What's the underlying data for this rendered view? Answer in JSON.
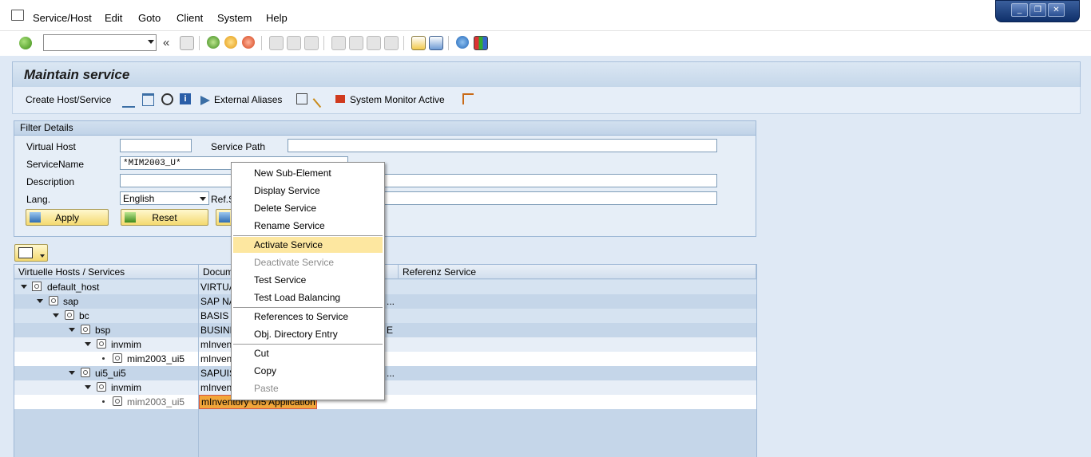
{
  "menubar": {
    "items": [
      "Service/Host",
      "Edit",
      "Goto",
      "Client",
      "System",
      "Help"
    ]
  },
  "window_controls": {
    "minimize": "_",
    "restore": "❐",
    "close": "✕"
  },
  "toolbar": {
    "command_field_value": "",
    "back_glyph": "«"
  },
  "title": "Maintain service",
  "app_toolbar": {
    "create": "Create Host/Service",
    "external_aliases": "External Aliases",
    "system_monitor": "System Monitor Active"
  },
  "filter": {
    "group_title": "Filter Details",
    "virtual_host_label": "Virtual Host",
    "virtual_host_value": "",
    "service_path_label": "Service Path",
    "service_path_value": "",
    "service_name_label": "ServiceName",
    "service_name_value": "*MIM2003_U*",
    "description_label": "Description",
    "description_value": "",
    "lang_label": "Lang.",
    "lang_value": "English",
    "ref_service_label": "Ref.S",
    "apply": "Apply",
    "reset": "Reset"
  },
  "tree": {
    "columns": [
      "Virtuelle Hosts / Services",
      "Docum",
      "Referenz Service"
    ],
    "rows": [
      {
        "name": "default_host",
        "doc": "VIRTUA",
        "extra": ""
      },
      {
        "name": "sap",
        "doc": "SAP NA",
        "extra": "..."
      },
      {
        "name": "bc",
        "doc": "BASIS T",
        "extra": ""
      },
      {
        "name": "bsp",
        "doc": "BUSINE",
        "extra": "E"
      },
      {
        "name": "invmim",
        "doc": "mInven",
        "extra": ""
      },
      {
        "name": "mim2003_ui5",
        "doc": "mInven",
        "extra": ""
      },
      {
        "name": "ui5_ui5",
        "doc": "SAPUIS",
        "extra": "..."
      },
      {
        "name": "invmim",
        "doc": "mInven",
        "extra": ""
      },
      {
        "name": "mim2003_ui5",
        "doc": "mInventory UI5 Application",
        "extra": ""
      }
    ]
  },
  "context_menu": {
    "items": [
      {
        "label": "New Sub-Element",
        "state": "normal"
      },
      {
        "label": "Display Service",
        "state": "normal"
      },
      {
        "label": "Delete Service",
        "state": "normal"
      },
      {
        "label": "Rename Service",
        "state": "normal"
      },
      {
        "label": "Activate Service",
        "state": "highlighted"
      },
      {
        "label": "Deactivate Service",
        "state": "disabled"
      },
      {
        "label": "Test Service",
        "state": "normal"
      },
      {
        "label": "Test Load Balancing",
        "state": "normal"
      },
      {
        "label": "References to Service",
        "state": "normal"
      },
      {
        "label": "Obj. Directory Entry",
        "state": "normal"
      },
      {
        "label": "Cut",
        "state": "normal"
      },
      {
        "label": "Copy",
        "state": "normal"
      },
      {
        "label": "Paste",
        "state": "disabled"
      }
    ]
  },
  "colors": {
    "highlight": "#fde7a0",
    "selected_cell": "#f2a63a",
    "button_yellow": "#f4d96f",
    "tree_bg": "#c5d6e9"
  }
}
